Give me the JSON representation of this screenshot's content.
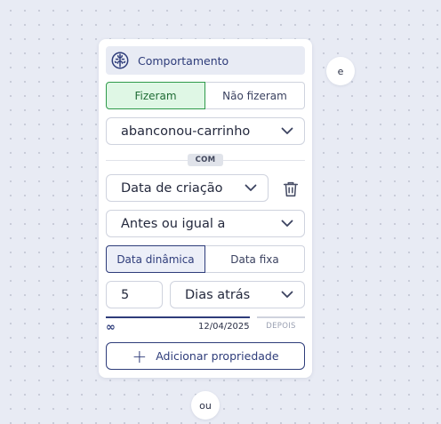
{
  "colors": {
    "canvas": "#e8ebf4",
    "accent": "#2e3c7a",
    "success_bg": "#dff7e5",
    "success_border": "#2f9a4a"
  },
  "connectors": {
    "and_label": "e",
    "or_label": "ou"
  },
  "card": {
    "header": {
      "icon": "brain-icon",
      "title": "Comportamento"
    },
    "did_toggle": {
      "options": [
        "Fizeram",
        "Não fizeram"
      ],
      "selected": "Fizeram"
    },
    "event_select": {
      "value": "abanconou-carrinho"
    },
    "with_badge": "COM",
    "property_select": {
      "value": "Data de criação"
    },
    "delete_icon": "trash-icon",
    "operator_select": {
      "value": "Antes ou igual a"
    },
    "date_mode_toggle": {
      "options": [
        "Data dinâmica",
        "Data fixa"
      ],
      "selected": "Data dinâmica"
    },
    "amount": "5",
    "unit_select": {
      "value": "Dias atrás"
    },
    "range": {
      "start_label": "∞",
      "date_label": "12/04/2025",
      "after_label": "DEPOIS"
    },
    "add_property_button": {
      "icon": "plus-icon",
      "label": "Adicionar propriedade"
    }
  }
}
